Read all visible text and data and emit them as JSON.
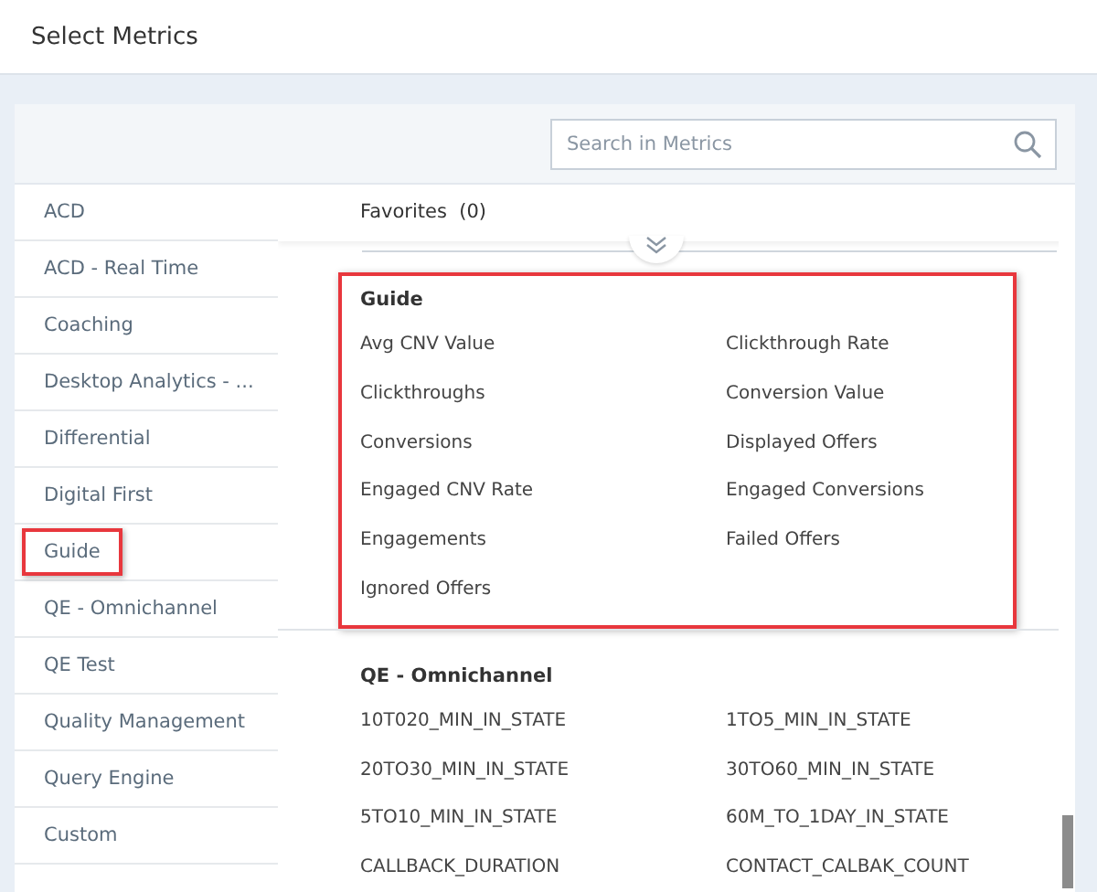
{
  "window": {
    "title": "Select Metrics"
  },
  "search": {
    "placeholder": "Search in Metrics"
  },
  "sidebar": {
    "items": [
      {
        "label": "ACD",
        "highlighted": false
      },
      {
        "label": "ACD - Real Time",
        "highlighted": false
      },
      {
        "label": "Coaching",
        "highlighted": false
      },
      {
        "label": "Desktop Analytics - ...",
        "highlighted": false
      },
      {
        "label": "Differential",
        "highlighted": false
      },
      {
        "label": "Digital First",
        "highlighted": false
      },
      {
        "label": "Guide",
        "highlighted": true
      },
      {
        "label": "QE - Omnichannel",
        "highlighted": false
      },
      {
        "label": "QE Test",
        "highlighted": false
      },
      {
        "label": "Quality Management",
        "highlighted": false
      },
      {
        "label": "Query Engine",
        "highlighted": false
      },
      {
        "label": "Custom",
        "highlighted": false
      }
    ]
  },
  "favorites": {
    "label": "Favorites",
    "count": "(0)",
    "expanded": false
  },
  "sections": [
    {
      "title": "Guide",
      "highlighted": true,
      "metrics": [
        "Avg CNV Value",
        "Clickthrough Rate",
        "Clickthroughs",
        "Conversion Value",
        "Conversions",
        "Displayed Offers",
        "Engaged CNV Rate",
        "Engaged Conversions",
        "Engagements",
        "Failed Offers",
        "Ignored Offers"
      ]
    },
    {
      "title": "QE - Omnichannel",
      "highlighted": false,
      "metrics": [
        "10T020_MIN_IN_STATE",
        "1TO5_MIN_IN_STATE",
        "20TO30_MIN_IN_STATE",
        "30TO60_MIN_IN_STATE",
        "5TO10_MIN_IN_STATE",
        "60M_TO_1DAY_IN_STATE",
        "CALLBACK_DURATION",
        "CONTACT_CALBAK_COUNT"
      ]
    }
  ]
}
